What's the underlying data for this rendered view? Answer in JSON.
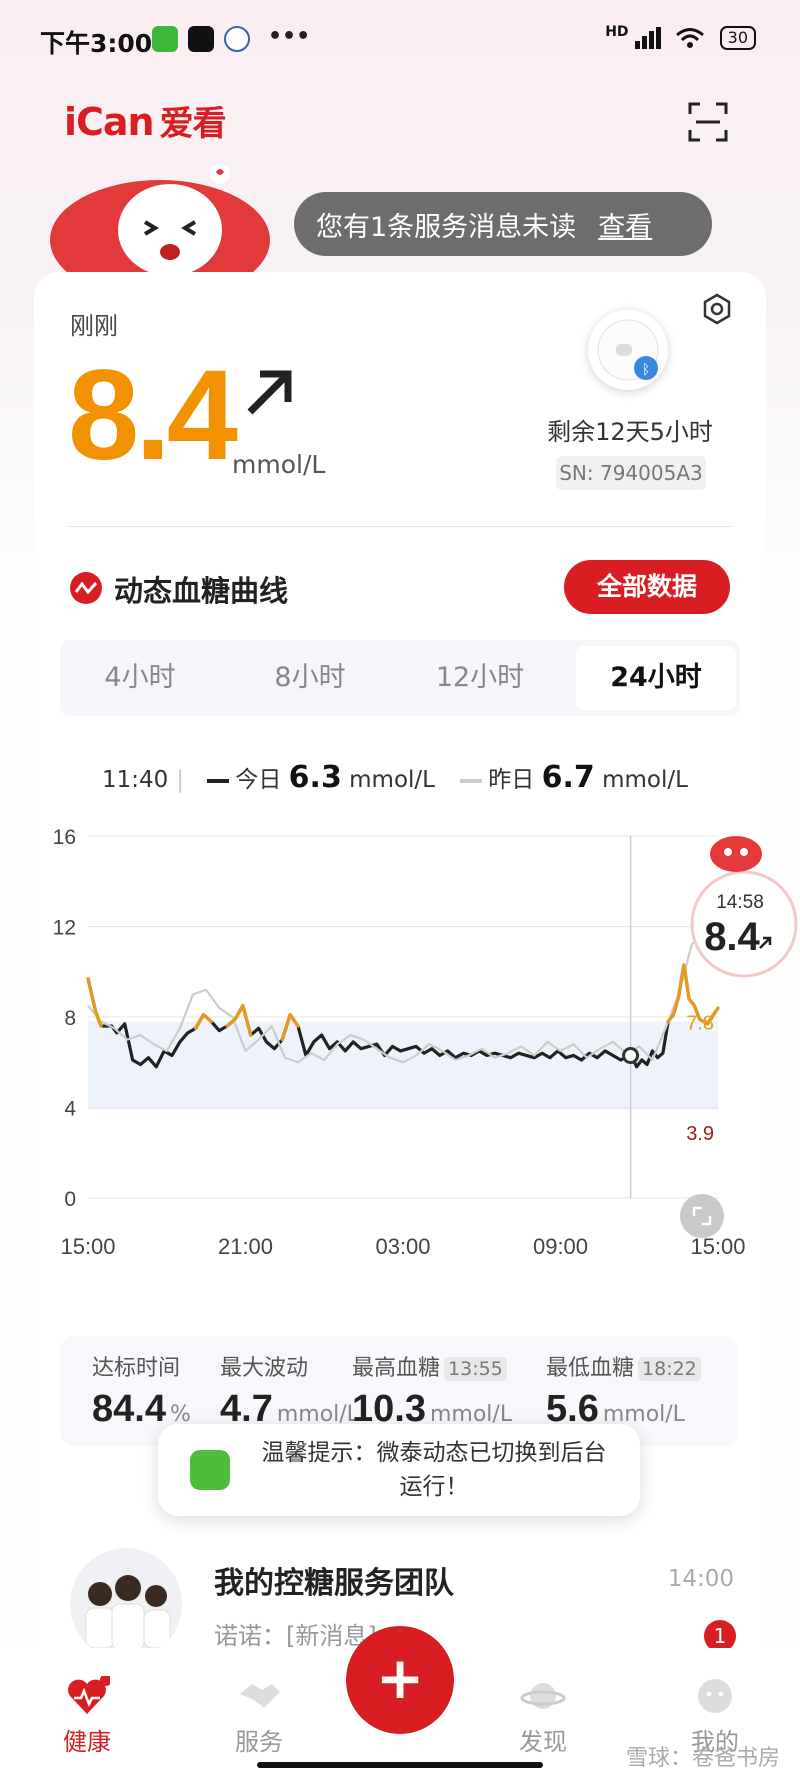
{
  "status_bar": {
    "time": "下午3:00",
    "battery": "30",
    "dots": "•••",
    "signal": "HD"
  },
  "header": {
    "logo_main": "iCan",
    "logo_cn": "爱看"
  },
  "message": {
    "text": "您有1条服务消息未读",
    "link": "查看"
  },
  "reading": {
    "label": "刚刚",
    "value": "8.4",
    "unit": "mmol/L"
  },
  "sensor": {
    "remaining": "剩余12天5小时",
    "sn": "SN: 794005A3"
  },
  "curve": {
    "title": "动态血糖曲线",
    "all_data_button": "全部数据"
  },
  "tabs": [
    {
      "label": "4小时"
    },
    {
      "label": "8小时"
    },
    {
      "label": "12小时"
    },
    {
      "label": "24小时"
    }
  ],
  "legend": {
    "time": "11:40",
    "today_label": "今日",
    "today_value": "6.3",
    "yesterday_label": "昨日",
    "yesterday_value": "6.7",
    "unit": "mmol/L"
  },
  "chart_data": {
    "type": "line",
    "x_ticks": [
      "15:00",
      "21:00",
      "03:00",
      "09:00",
      "15:00"
    ],
    "ylim": [
      0,
      16
    ],
    "y_ticks": [
      0,
      4,
      8,
      12,
      16
    ],
    "target_range": [
      3.9,
      7.8
    ],
    "target_labels": [
      "7.8",
      "3.9"
    ],
    "series": [
      {
        "name": "今日",
        "color": "#222222",
        "x": [
          0,
          0.3,
          0.5,
          0.9,
          1.1,
          1.4,
          1.7,
          2.0,
          2.3,
          2.6,
          2.9,
          3.2,
          3.5,
          3.8,
          4.1,
          4.4,
          4.7,
          5.0,
          5.3,
          5.6,
          5.9,
          6.2,
          6.5,
          6.8,
          7.1,
          7.4,
          7.7,
          8.0,
          8.3,
          8.6,
          8.9,
          9.2,
          9.5,
          9.8,
          10.1,
          10.4,
          10.7,
          11.0,
          11.3,
          11.6,
          11.9,
          12.2,
          12.5,
          12.8,
          13.1,
          13.4,
          13.7,
          14.0,
          14.3,
          14.6,
          14.9,
          15.2,
          15.5,
          15.8,
          16.1,
          16.4,
          16.7,
          17.0,
          17.3,
          17.6,
          17.9,
          18.2,
          18.5,
          18.8,
          19.1,
          19.4,
          19.7,
          20.0,
          20.3,
          20.6,
          20.7,
          20.9,
          21.1,
          21.3,
          21.5,
          21.7,
          21.9,
          22.1,
          22.3,
          22.5,
          22.7,
          22.9,
          23.1,
          23.3,
          23.6,
          24.0
        ],
        "values": [
          9.7,
          8.2,
          7.6,
          7.6,
          7.3,
          7.7,
          6.1,
          5.9,
          6.2,
          5.8,
          6.5,
          6.3,
          6.9,
          7.3,
          7.5,
          8.1,
          7.8,
          7.4,
          7.6,
          7.9,
          8.5,
          7.2,
          7.5,
          6.9,
          6.6,
          7.0,
          8.1,
          7.6,
          6.3,
          6.9,
          7.2,
          6.6,
          6.9,
          6.5,
          6.9,
          6.6,
          6.7,
          6.8,
          6.3,
          6.7,
          6.5,
          6.6,
          6.7,
          6.4,
          6.6,
          6.3,
          6.5,
          6.2,
          6.4,
          6.3,
          6.5,
          6.3,
          6.4,
          6.3,
          6.2,
          6.4,
          6.3,
          6.2,
          6.4,
          6.2,
          6.5,
          6.2,
          6.3,
          6.1,
          6.4,
          6.2,
          6.5,
          6.3,
          6.1,
          6.3,
          6.3,
          5.8,
          6.1,
          5.9,
          6.5,
          6.2,
          6.4,
          7.8,
          8.1,
          8.9,
          10.3,
          8.8,
          8.5,
          7.9,
          7.7,
          8.4
        ]
      },
      {
        "name": "昨日",
        "color": "#cccccc",
        "x": [
          0,
          0.5,
          1.0,
          1.5,
          2.0,
          2.5,
          3.0,
          3.5,
          4.0,
          4.5,
          5.0,
          5.5,
          6.0,
          6.5,
          7.0,
          7.5,
          8.0,
          8.5,
          9.0,
          9.5,
          10.0,
          10.5,
          11.0,
          11.5,
          12.0,
          12.5,
          13.0,
          13.5,
          14.0,
          14.5,
          15.0,
          15.5,
          16.0,
          16.5,
          17.0,
          17.5,
          18.0,
          18.5,
          19.0,
          19.5,
          20.0,
          20.5,
          21.0,
          21.5,
          22.0,
          22.5,
          23.0,
          23.5,
          24.0
        ],
        "values": [
          8.5,
          7.8,
          7.5,
          7.0,
          7.2,
          6.8,
          6.5,
          7.5,
          9.0,
          9.2,
          8.4,
          8.0,
          6.5,
          7.0,
          7.6,
          6.2,
          6.0,
          6.4,
          6.1,
          6.8,
          7.2,
          7.0,
          6.6,
          6.2,
          6.0,
          6.3,
          6.8,
          6.5,
          6.1,
          6.3,
          6.6,
          6.2,
          6.4,
          6.7,
          6.3,
          6.9,
          6.5,
          6.8,
          6.2,
          6.6,
          6.9,
          6.4,
          6.7,
          6.1,
          7.5,
          9.0,
          11.2,
          11.8,
          12.3
        ]
      }
    ],
    "current_marker": {
      "time": "14:58",
      "value": "8.4"
    }
  },
  "stats": [
    {
      "label": "达标时间",
      "value": "84.4",
      "unit": "%",
      "time": ""
    },
    {
      "label": "最大波动",
      "value": "4.7",
      "unit": "mmol/L",
      "time": ""
    },
    {
      "label": "最高血糖",
      "value": "10.3",
      "unit": "mmol/L",
      "time": "13:55"
    },
    {
      "label": "最低血糖",
      "value": "5.6",
      "unit": "mmol/L",
      "time": "18:22"
    }
  ],
  "toast": {
    "text": "温馨提示：微泰动态已切换到后台运行！"
  },
  "team": {
    "title": "我的控糖服务团队",
    "subtitle": "诺诺：[新消息]",
    "time": "14:00",
    "badge": "1"
  },
  "nav": [
    {
      "label": "健康"
    },
    {
      "label": "服务"
    },
    {
      "label": "发现"
    },
    {
      "label": "我的"
    }
  ],
  "nav_plus": "+",
  "watermark": "雪球：卷爸书房",
  "colors": {
    "brand": "#d81e23",
    "value_orange": "#f39200",
    "high_orange": "#e89a1a",
    "target_band": "#eef3fb"
  }
}
